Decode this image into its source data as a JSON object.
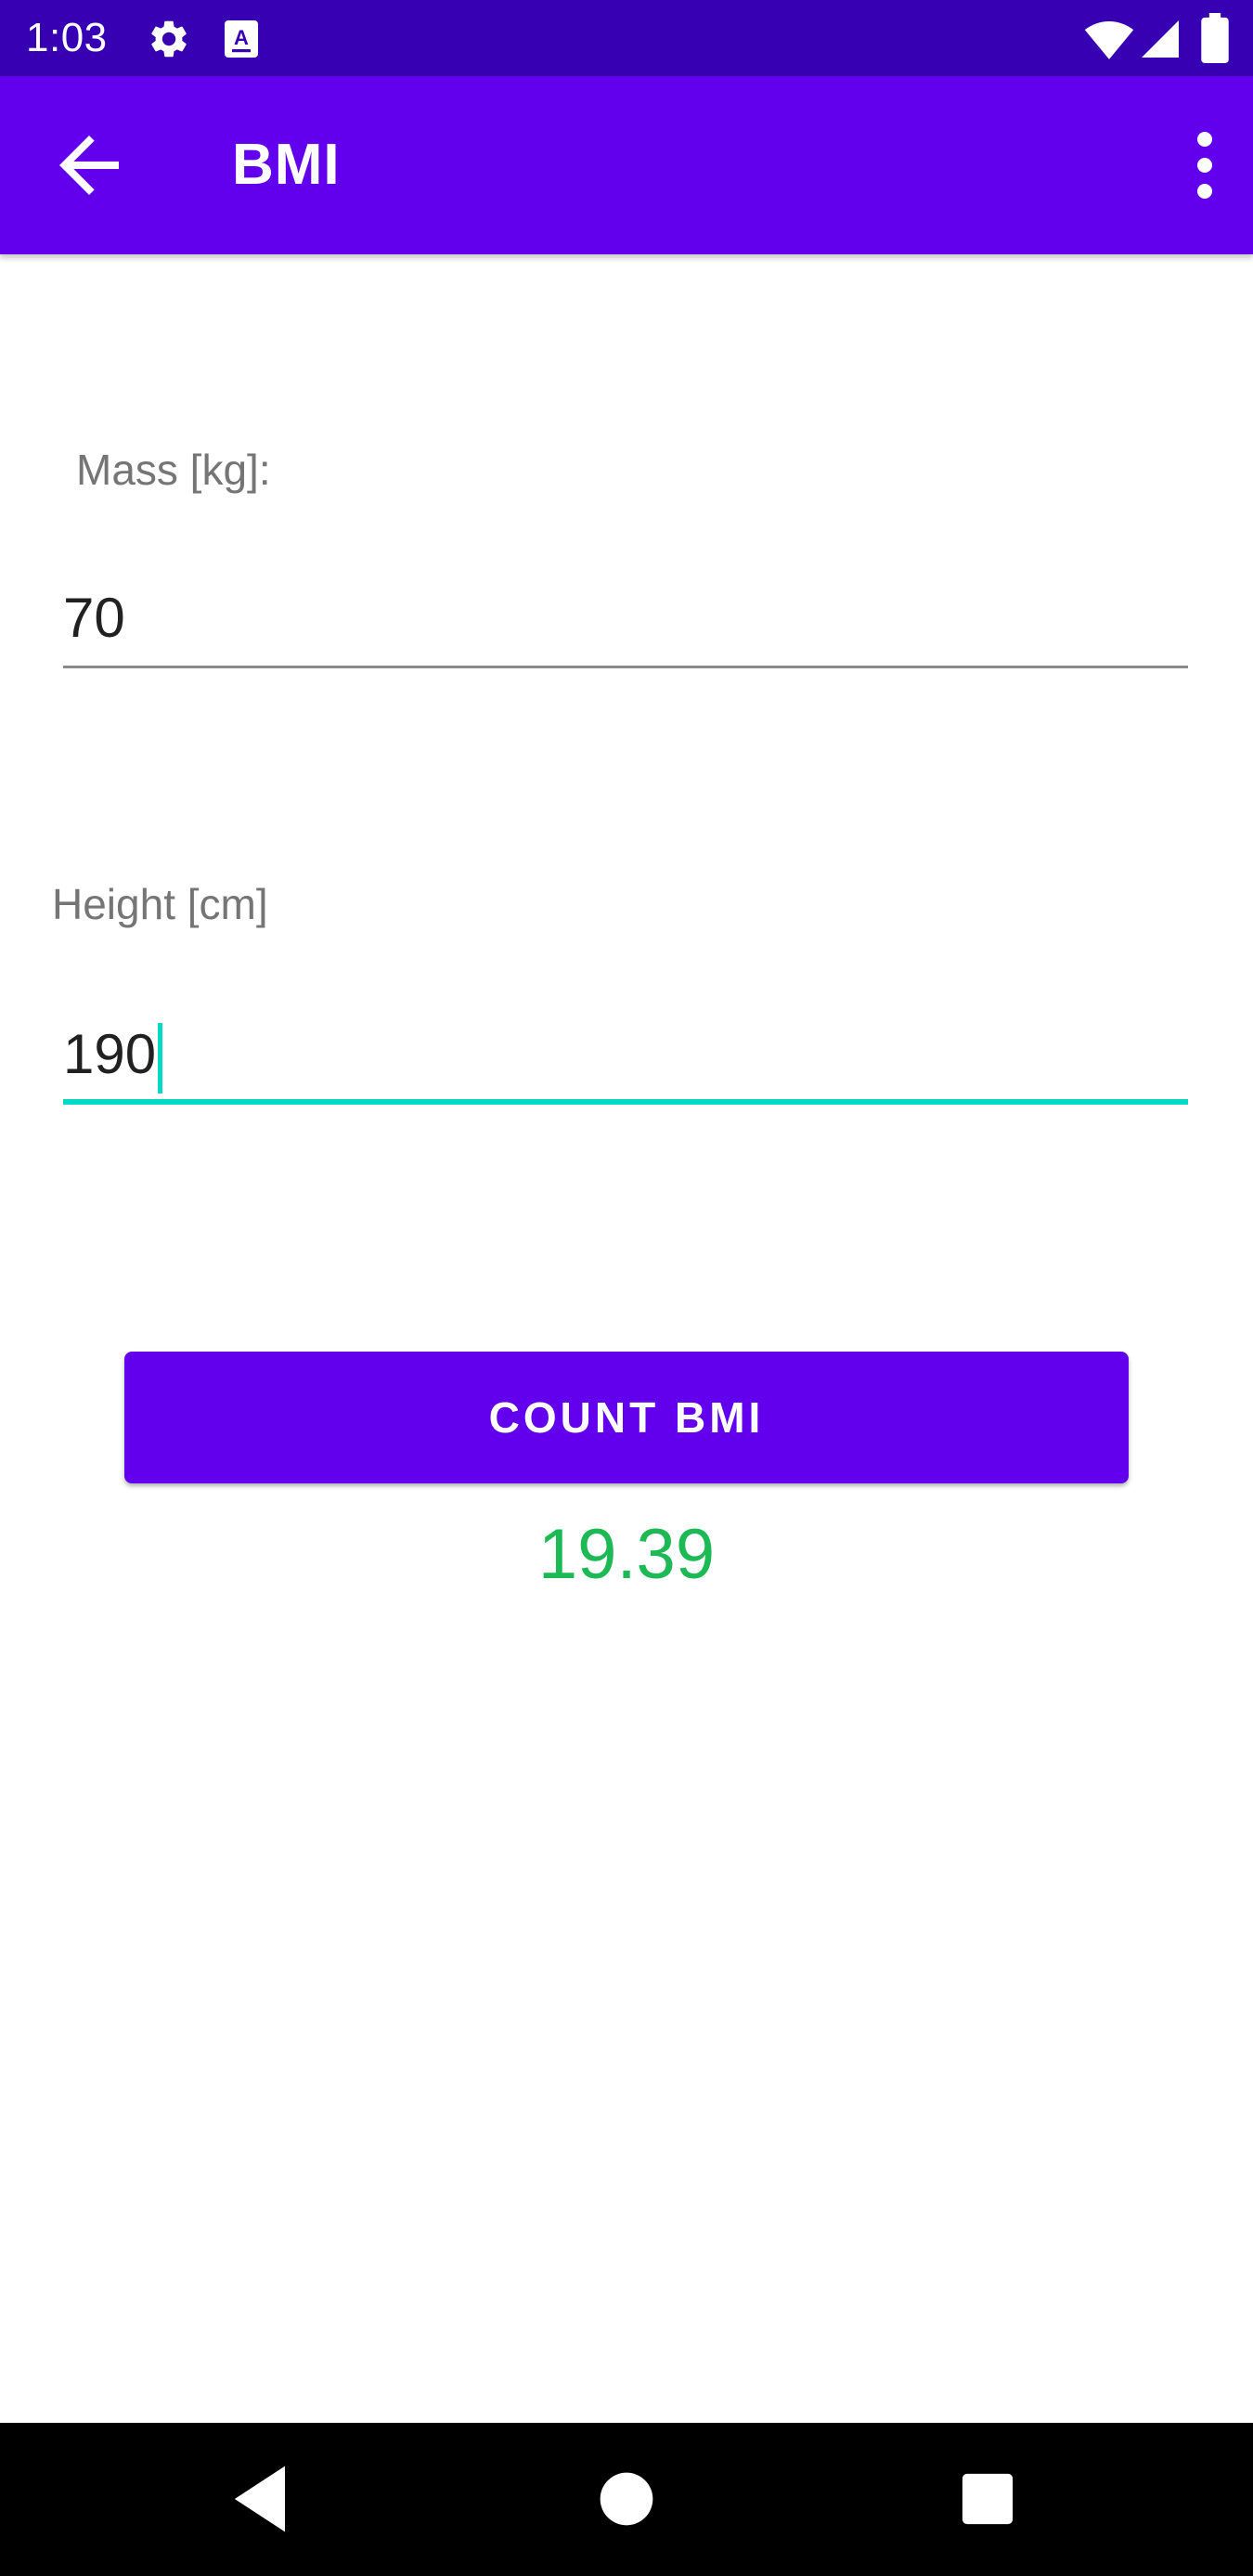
{
  "status_bar": {
    "time": "1:03",
    "icons": [
      "settings-icon",
      "font-accessibility-icon",
      "wifi-icon",
      "signal-icon",
      "battery-icon"
    ]
  },
  "app_bar": {
    "title": "BMI",
    "back_icon": "arrow-back-icon",
    "overflow_icon": "more-vert-icon"
  },
  "form": {
    "mass_label": "Mass [kg]:",
    "mass_value": "70",
    "height_label": "Height [cm]",
    "height_value": "190"
  },
  "button": {
    "label": "COUNT BMI"
  },
  "result": {
    "value": "19.39"
  },
  "nav_bar": {
    "icons": [
      "back-triangle-icon",
      "home-circle-icon",
      "recents-square-icon"
    ]
  },
  "colors": {
    "status_bar": "#3700B3",
    "primary": "#6200EE",
    "accent": "#03DAC5",
    "result": "#1DB954",
    "label": "#757575"
  }
}
